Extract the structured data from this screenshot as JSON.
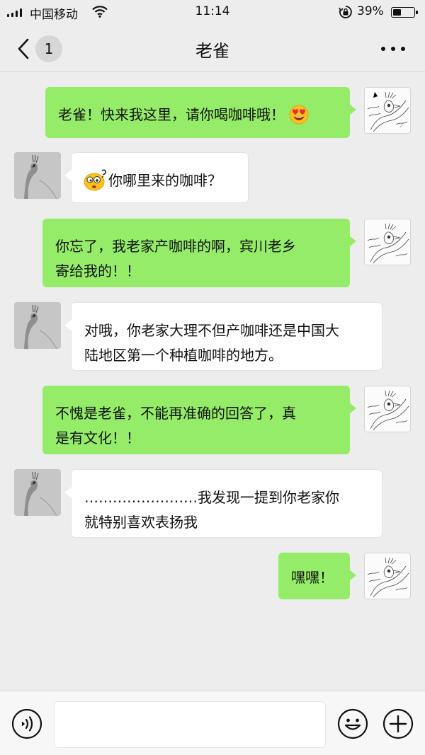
{
  "status_bar": {
    "carrier": "中国移动",
    "time": "11:14",
    "battery_text": "39%",
    "battery_level": 0.39,
    "icons": [
      "signal-icon",
      "wifi-icon",
      "rotation-lock-icon",
      "battery-icon"
    ]
  },
  "nav": {
    "back_icon": "chevron-left-icon",
    "unread_count": "1",
    "title": "老雀",
    "more_icon": "more-dots-icon"
  },
  "messages": [
    {
      "side": "out",
      "text": "老雀！快来我这里，请你喝咖啡哦！",
      "emoji": "heart-eyes-emoji"
    },
    {
      "side": "in",
      "text": "你哪里来的咖啡？",
      "emoji_before": "confused-sticker-emoji"
    },
    {
      "side": "out",
      "line1": "你忘了，我老家产咖啡的啊，宾川老乡",
      "line2": "寄给我的！！"
    },
    {
      "side": "in",
      "line1": "对哦，你老家大理不但产咖啡还是中国大",
      "line2": "陆地区第一个种植咖啡的地方。"
    },
    {
      "side": "out",
      "line1": "不愧是老雀，不能再准确的回答了，真",
      "line2": "是有文化！！"
    },
    {
      "side": "in",
      "line1": "……………………我发现一提到你老家你",
      "line2": "就特别喜欢表扬我"
    },
    {
      "side": "out",
      "text": "嘿嘿！"
    }
  ],
  "input_bar": {
    "voice_icon": "voice-icon",
    "input_value": "",
    "emoji_icon": "emoji-icon",
    "plus_icon": "plus-icon"
  },
  "colors": {
    "outgoing_bubble": "#95ec69",
    "incoming_bubble": "#ffffff",
    "background": "#ededed"
  }
}
